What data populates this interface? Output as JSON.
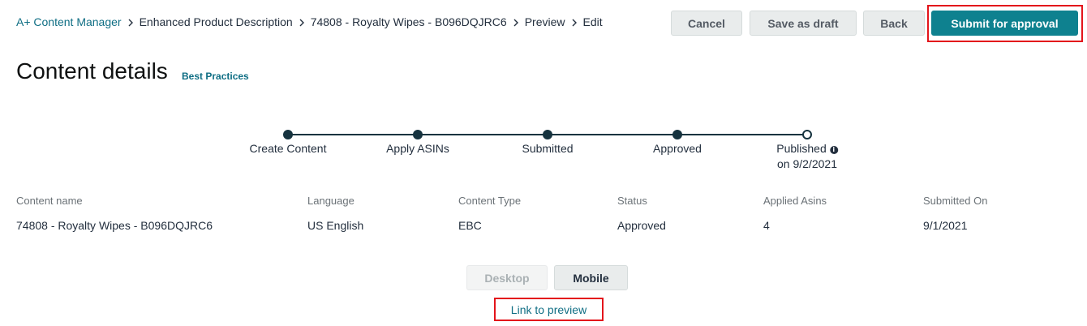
{
  "breadcrumb": {
    "items": [
      {
        "label": "A+ Content Manager"
      },
      {
        "label": "Enhanced Product Description"
      },
      {
        "label": "74808 - Royalty Wipes - B096DQJRC6"
      },
      {
        "label": "Preview"
      },
      {
        "label": "Edit"
      }
    ],
    "separator_icon": "chevron-right-icon"
  },
  "header": {
    "cancel_label": "Cancel",
    "draft_label": "Save as draft",
    "back_label": "Back",
    "submit_label": "Submit for approval"
  },
  "page": {
    "title": "Content details",
    "best_practices_label": "Best Practices"
  },
  "stepper": {
    "steps": [
      {
        "label": "Create Content",
        "completed": true
      },
      {
        "label": "Apply ASINs",
        "completed": true
      },
      {
        "label": "Submitted",
        "completed": true
      },
      {
        "label": "Approved",
        "completed": true
      },
      {
        "label": "Published",
        "sublabel": "on 9/2/2021",
        "completed": false,
        "icon": "info-icon"
      }
    ]
  },
  "details": {
    "columns": [
      {
        "header": "Content name",
        "value": "74808 - Royalty Wipes - B096DQJRC6"
      },
      {
        "header": "Language",
        "value": "US English"
      },
      {
        "header": "Content Type",
        "value": "EBC"
      },
      {
        "header": "Status",
        "value": "Approved"
      },
      {
        "header": "Applied Asins",
        "value": "4"
      },
      {
        "header": "Submitted On",
        "value": "9/1/2021"
      }
    ]
  },
  "view": {
    "desktop_label": "Desktop",
    "mobile_label": "Mobile",
    "preview_link_label": "Link to preview"
  },
  "colors": {
    "accent": "#0e818f",
    "link": "#0f6e84",
    "highlight": "#e3141b",
    "stepper": "#16333f"
  }
}
